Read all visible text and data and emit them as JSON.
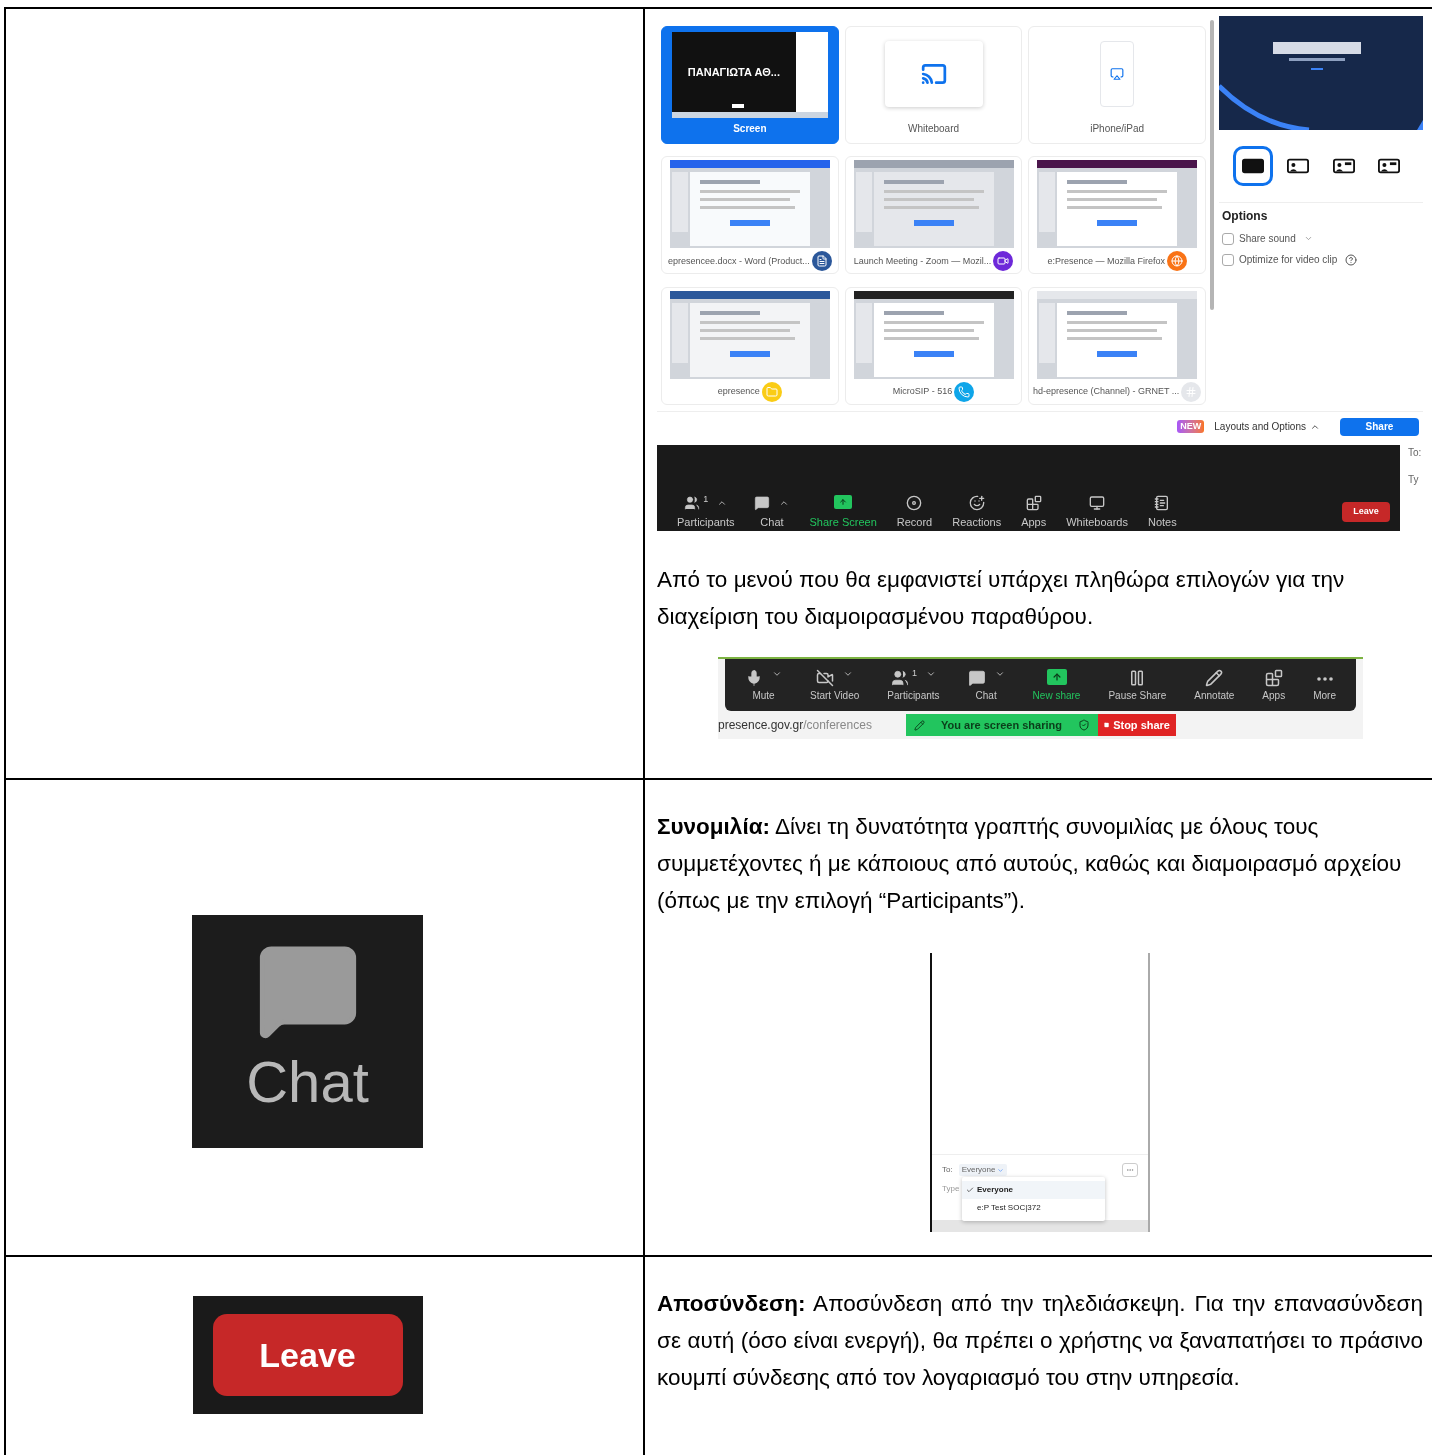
{
  "share_row": {
    "share_dialog": {
      "tiles": [
        {
          "kind": "screen",
          "label": "Screen",
          "caption": "ΠΑΝΑΓΙΩΤΑ ΑΘ...",
          "selected": true
        },
        {
          "kind": "whiteboard",
          "label": "Whiteboard",
          "selected": false
        },
        {
          "kind": "device",
          "label": "iPhone/iPad",
          "selected": false
        },
        {
          "kind": "window",
          "label": "epresencee.docx - Word (Product...",
          "selected": false
        },
        {
          "kind": "window",
          "label": "Launch Meeting - Zoom — Mozil...",
          "selected": false
        },
        {
          "kind": "window",
          "label": "e:Presence — Mozilla Firefox",
          "selected": false
        },
        {
          "kind": "window",
          "label": "epresence",
          "selected": false
        },
        {
          "kind": "window",
          "label": "MicroSIP - 516",
          "selected": false
        },
        {
          "kind": "window",
          "label": "hd-epresence (Channel) - GRNET ...",
          "selected": false
        }
      ],
      "layouts": [
        {
          "selected": true
        },
        {
          "selected": false
        },
        {
          "selected": false
        },
        {
          "selected": false
        }
      ],
      "options_title": "Options",
      "options": [
        {
          "label": "Share sound",
          "checked": false,
          "menu": true,
          "help": false
        },
        {
          "label": "Optimize for video clip",
          "checked": false,
          "menu": false,
          "help": true
        }
      ],
      "new_badge": "NEW",
      "layouts_link": "Layouts and Options",
      "share_button": "Share"
    },
    "meeting_toolbar": {
      "items": [
        {
          "kind": "participants",
          "label": "Participants",
          "count": "1",
          "menu": true,
          "active": false
        },
        {
          "kind": "chat",
          "label": "Chat",
          "menu": true,
          "active": false
        },
        {
          "kind": "share",
          "label": "Share Screen",
          "menu": false,
          "active": true
        },
        {
          "kind": "record",
          "label": "Record",
          "menu": false,
          "active": false
        },
        {
          "kind": "reactions",
          "label": "Reactions",
          "menu": false,
          "active": false
        },
        {
          "kind": "apps",
          "label": "Apps",
          "menu": false,
          "active": false
        },
        {
          "kind": "whiteboards",
          "label": "Whiteboards",
          "menu": false,
          "active": false
        },
        {
          "kind": "notes",
          "label": "Notes",
          "menu": false,
          "active": false
        }
      ],
      "leave_button": "Leave",
      "side_texts": [
        "To:",
        "Ty"
      ]
    },
    "description": "Από το μενού που θα εμφανιστεί υπάρχει πληθώρα επιλογών για την διαχείριση του διαμοιρασμένου παραθύρου.",
    "sharing_toolbar": {
      "items": [
        {
          "kind": "mute",
          "label": "Mute",
          "menu": true,
          "active": false
        },
        {
          "kind": "video",
          "label": "Start Video",
          "menu": true,
          "active": false
        },
        {
          "kind": "participants",
          "label": "Participants",
          "count": "1",
          "menu": true,
          "active": false
        },
        {
          "kind": "chat",
          "label": "Chat",
          "menu": true,
          "active": false
        },
        {
          "kind": "share",
          "label": "New share",
          "menu": false,
          "active": true
        },
        {
          "kind": "pause",
          "label": "Pause Share",
          "menu": false,
          "active": false
        },
        {
          "kind": "annotate",
          "label": "Annotate",
          "menu": false,
          "active": false
        },
        {
          "kind": "apps",
          "label": "Apps",
          "menu": false,
          "active": false
        },
        {
          "kind": "more",
          "label": "More",
          "menu": false,
          "active": false
        }
      ],
      "url_host": "presence.gov.gr",
      "url_path": "/conferences",
      "sharing_banner": "You are screen sharing",
      "stop_button": "Stop share"
    }
  },
  "chat_row": {
    "icon_label": "Chat",
    "description": "**Συνομιλία:** Δίνει τη δυνατότητα γραπτής συνομιλίας με όλους τους συμμετέχοντες ή με κάποιους από αυτούς, καθώς και διαμοιρασμό αρχείου (όπως με την επιλογή “Participants”).",
    "chat_panel": {
      "to_label": "To:",
      "recipient": "Everyone",
      "type_hint": "Type",
      "menu": [
        {
          "label": "Everyone",
          "selected": true
        },
        {
          "label": "e:P Test SOC|372",
          "selected": false
        }
      ]
    }
  },
  "leave_row": {
    "button_label": "Leave",
    "description": "**Αποσύνδεση:** Αποσύνδεση από την τηλεδιάσκεψη. Για την επανασύνδεση σε αυτή (όσο είναι ενεργή), θα πρέπει ο χρήστης να ξαναπατήσει το πράσινο κουμπί σύνδεσης από τον λογαριασμό του στην υπηρεσία."
  }
}
